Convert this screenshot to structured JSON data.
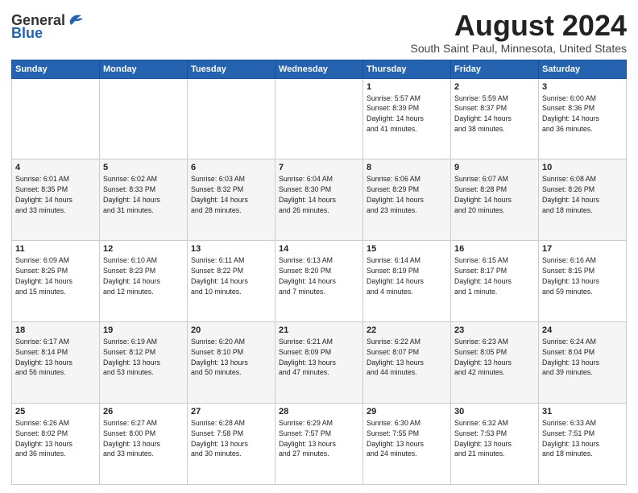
{
  "logo": {
    "general": "General",
    "blue": "Blue"
  },
  "header": {
    "month_year": "August 2024",
    "location": "South Saint Paul, Minnesota, United States"
  },
  "weekdays": [
    "Sunday",
    "Monday",
    "Tuesday",
    "Wednesday",
    "Thursday",
    "Friday",
    "Saturday"
  ],
  "weeks": [
    [
      {
        "day": "",
        "info": ""
      },
      {
        "day": "",
        "info": ""
      },
      {
        "day": "",
        "info": ""
      },
      {
        "day": "",
        "info": ""
      },
      {
        "day": "1",
        "info": "Sunrise: 5:57 AM\nSunset: 8:39 PM\nDaylight: 14 hours\nand 41 minutes."
      },
      {
        "day": "2",
        "info": "Sunrise: 5:59 AM\nSunset: 8:37 PM\nDaylight: 14 hours\nand 38 minutes."
      },
      {
        "day": "3",
        "info": "Sunrise: 6:00 AM\nSunset: 8:36 PM\nDaylight: 14 hours\nand 36 minutes."
      }
    ],
    [
      {
        "day": "4",
        "info": "Sunrise: 6:01 AM\nSunset: 8:35 PM\nDaylight: 14 hours\nand 33 minutes."
      },
      {
        "day": "5",
        "info": "Sunrise: 6:02 AM\nSunset: 8:33 PM\nDaylight: 14 hours\nand 31 minutes."
      },
      {
        "day": "6",
        "info": "Sunrise: 6:03 AM\nSunset: 8:32 PM\nDaylight: 14 hours\nand 28 minutes."
      },
      {
        "day": "7",
        "info": "Sunrise: 6:04 AM\nSunset: 8:30 PM\nDaylight: 14 hours\nand 26 minutes."
      },
      {
        "day": "8",
        "info": "Sunrise: 6:06 AM\nSunset: 8:29 PM\nDaylight: 14 hours\nand 23 minutes."
      },
      {
        "day": "9",
        "info": "Sunrise: 6:07 AM\nSunset: 8:28 PM\nDaylight: 14 hours\nand 20 minutes."
      },
      {
        "day": "10",
        "info": "Sunrise: 6:08 AM\nSunset: 8:26 PM\nDaylight: 14 hours\nand 18 minutes."
      }
    ],
    [
      {
        "day": "11",
        "info": "Sunrise: 6:09 AM\nSunset: 8:25 PM\nDaylight: 14 hours\nand 15 minutes."
      },
      {
        "day": "12",
        "info": "Sunrise: 6:10 AM\nSunset: 8:23 PM\nDaylight: 14 hours\nand 12 minutes."
      },
      {
        "day": "13",
        "info": "Sunrise: 6:11 AM\nSunset: 8:22 PM\nDaylight: 14 hours\nand 10 minutes."
      },
      {
        "day": "14",
        "info": "Sunrise: 6:13 AM\nSunset: 8:20 PM\nDaylight: 14 hours\nand 7 minutes."
      },
      {
        "day": "15",
        "info": "Sunrise: 6:14 AM\nSunset: 8:19 PM\nDaylight: 14 hours\nand 4 minutes."
      },
      {
        "day": "16",
        "info": "Sunrise: 6:15 AM\nSunset: 8:17 PM\nDaylight: 14 hours\nand 1 minute."
      },
      {
        "day": "17",
        "info": "Sunrise: 6:16 AM\nSunset: 8:15 PM\nDaylight: 13 hours\nand 59 minutes."
      }
    ],
    [
      {
        "day": "18",
        "info": "Sunrise: 6:17 AM\nSunset: 8:14 PM\nDaylight: 13 hours\nand 56 minutes."
      },
      {
        "day": "19",
        "info": "Sunrise: 6:19 AM\nSunset: 8:12 PM\nDaylight: 13 hours\nand 53 minutes."
      },
      {
        "day": "20",
        "info": "Sunrise: 6:20 AM\nSunset: 8:10 PM\nDaylight: 13 hours\nand 50 minutes."
      },
      {
        "day": "21",
        "info": "Sunrise: 6:21 AM\nSunset: 8:09 PM\nDaylight: 13 hours\nand 47 minutes."
      },
      {
        "day": "22",
        "info": "Sunrise: 6:22 AM\nSunset: 8:07 PM\nDaylight: 13 hours\nand 44 minutes."
      },
      {
        "day": "23",
        "info": "Sunrise: 6:23 AM\nSunset: 8:05 PM\nDaylight: 13 hours\nand 42 minutes."
      },
      {
        "day": "24",
        "info": "Sunrise: 6:24 AM\nSunset: 8:04 PM\nDaylight: 13 hours\nand 39 minutes."
      }
    ],
    [
      {
        "day": "25",
        "info": "Sunrise: 6:26 AM\nSunset: 8:02 PM\nDaylight: 13 hours\nand 36 minutes."
      },
      {
        "day": "26",
        "info": "Sunrise: 6:27 AM\nSunset: 8:00 PM\nDaylight: 13 hours\nand 33 minutes."
      },
      {
        "day": "27",
        "info": "Sunrise: 6:28 AM\nSunset: 7:58 PM\nDaylight: 13 hours\nand 30 minutes."
      },
      {
        "day": "28",
        "info": "Sunrise: 6:29 AM\nSunset: 7:57 PM\nDaylight: 13 hours\nand 27 minutes."
      },
      {
        "day": "29",
        "info": "Sunrise: 6:30 AM\nSunset: 7:55 PM\nDaylight: 13 hours\nand 24 minutes."
      },
      {
        "day": "30",
        "info": "Sunrise: 6:32 AM\nSunset: 7:53 PM\nDaylight: 13 hours\nand 21 minutes."
      },
      {
        "day": "31",
        "info": "Sunrise: 6:33 AM\nSunset: 7:51 PM\nDaylight: 13 hours\nand 18 minutes."
      }
    ]
  ]
}
